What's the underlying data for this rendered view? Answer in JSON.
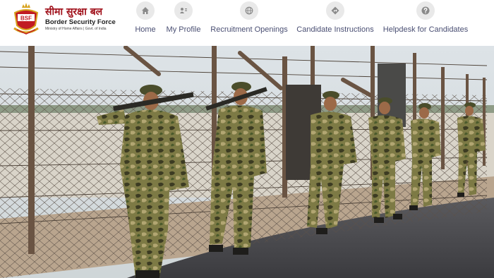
{
  "brand": {
    "name_hindi": "सीमा सुरक्षा बल",
    "name_english": "Border Security Force",
    "ministry": "Ministry of Home Affairs | Govt. of India",
    "emblem_text": "BSF",
    "colors": {
      "primary": "#a0101a",
      "accent": "#d7a21c"
    }
  },
  "nav": {
    "items": [
      {
        "label": "Home",
        "icon": "home-icon"
      },
      {
        "label": "My Profile",
        "icon": "user-id-icon"
      },
      {
        "label": "Recruitment Openings",
        "icon": "globe-icon"
      },
      {
        "label": "Candidate Instructions",
        "icon": "directions-icon"
      },
      {
        "label": "Helpdesk for Candidates",
        "icon": "question-icon"
      }
    ],
    "label_color": "#4a4f73",
    "icon_bg": "#e9e9e9"
  },
  "hero": {
    "subject": "BSF personnel patrolling along the border fence"
  }
}
